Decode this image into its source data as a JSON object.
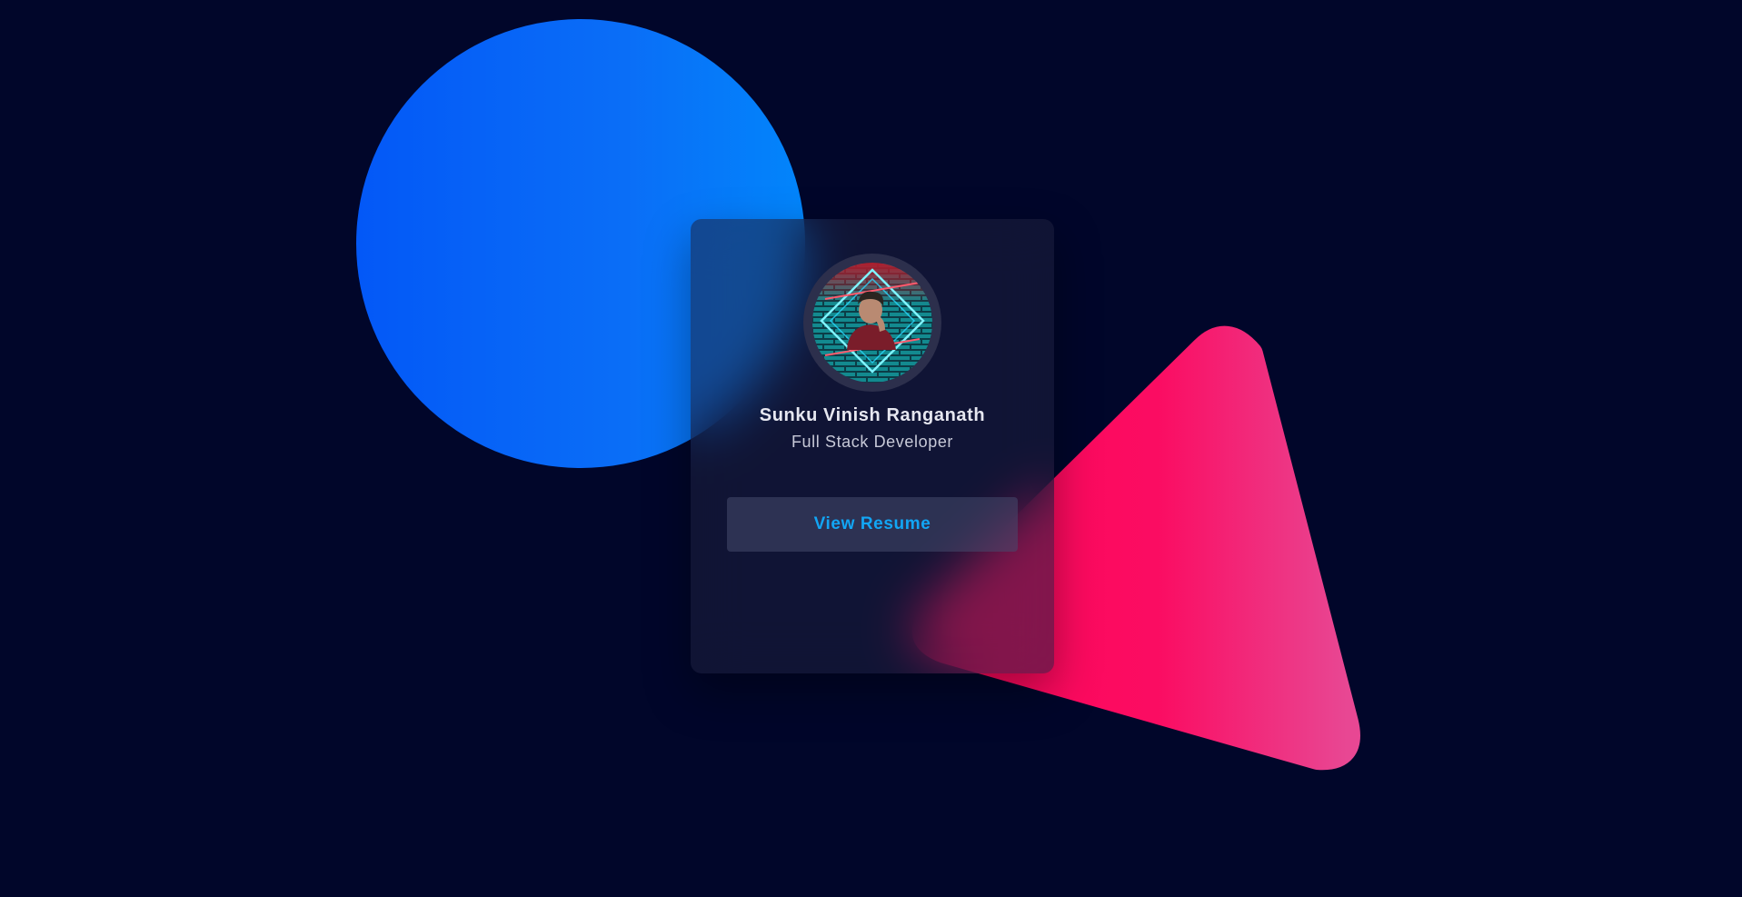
{
  "profile": {
    "name": "Sunku Vinish Ranganath",
    "role": "Full Stack Developer",
    "avatar_icon": "profile-photo-neon-frame"
  },
  "actions": {
    "view_resume_label": "View Resume"
  },
  "colors": {
    "background": "#01062a",
    "circle_start": "#0358f7",
    "circle_end": "#0285fb",
    "triangle_start": "#ff0659",
    "triangle_end": "#e84793",
    "button_text": "#12a6f5"
  }
}
